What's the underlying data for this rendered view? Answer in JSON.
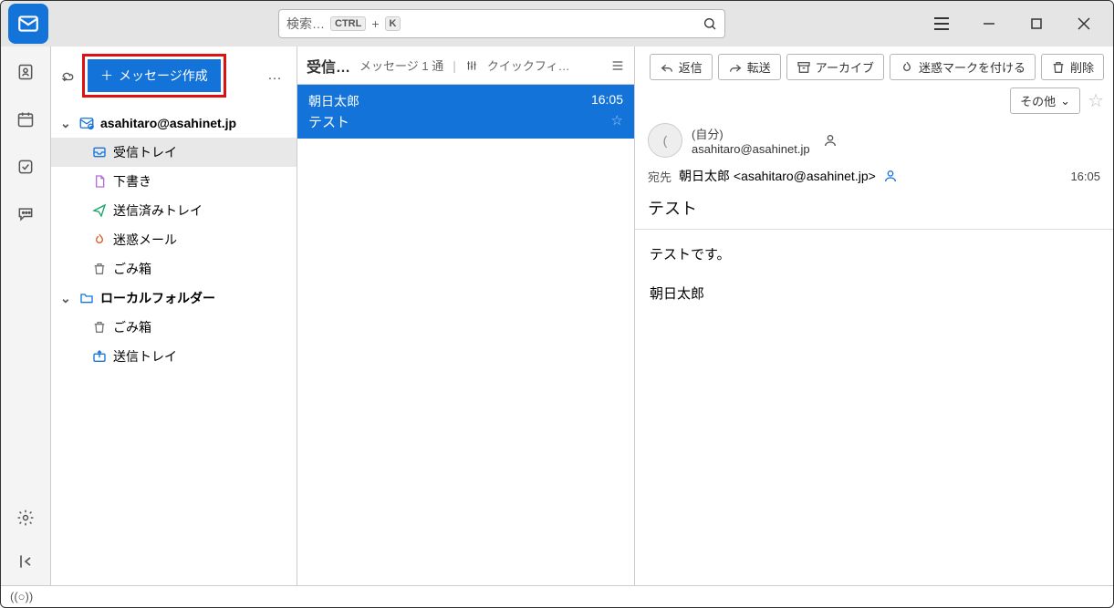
{
  "search": {
    "placeholder": "検索…",
    "kbd1": "CTRL",
    "plus": "+",
    "kbd2": "K"
  },
  "compose": {
    "label": "メッセージ作成"
  },
  "accounts": [
    {
      "name": "asahitaro@asahinet.jp",
      "folders": [
        {
          "label": "受信トレイ",
          "icon": "inbox",
          "selected": true
        },
        {
          "label": "下書き",
          "icon": "draft"
        },
        {
          "label": "送信済みトレイ",
          "icon": "sent"
        },
        {
          "label": "迷惑メール",
          "icon": "junk"
        },
        {
          "label": "ごみ箱",
          "icon": "trash"
        }
      ]
    },
    {
      "name": "ローカルフォルダー",
      "folders": [
        {
          "label": "ごみ箱",
          "icon": "trash"
        },
        {
          "label": "送信トレイ",
          "icon": "outbox"
        }
      ]
    }
  ],
  "msglist": {
    "title": "受信…",
    "count": "メッセージ 1 通",
    "quickfilter": "クイックフィ…",
    "items": [
      {
        "from": "朝日太郎",
        "subject": "テスト",
        "time": "16:05",
        "selected": true
      }
    ]
  },
  "toolbar": {
    "reply": "返信",
    "forward": "転送",
    "archive": "アーカイブ",
    "junk": "迷惑マークを付ける",
    "delete": "削除",
    "other": "その他"
  },
  "message": {
    "avatar_initial": "(",
    "self_label": "(自分)",
    "from_email": "asahitaro@asahinet.jp",
    "to_label": "宛先",
    "to_display": "朝日太郎 <asahitaro@asahinet.jp>",
    "time": "16:05",
    "subject": "テスト",
    "body_line1": "テストです。",
    "body_line2": "朝日太郎"
  },
  "status": {
    "sync": "((○))"
  }
}
